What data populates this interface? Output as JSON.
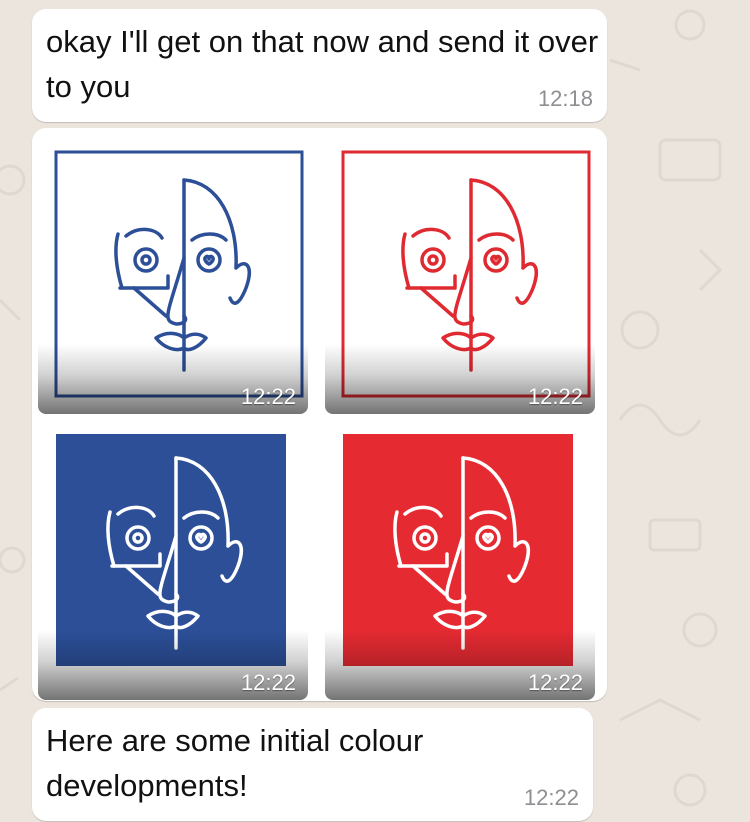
{
  "messages": [
    {
      "text": "okay I'll get on that now and send it over to you",
      "time": "12:18"
    },
    {
      "text": "Here are some initial colour developments!",
      "time": "12:22"
    }
  ],
  "gallery": {
    "images": [
      {
        "time": "12:22",
        "style": "blue-outline",
        "frame": "#2c4f98",
        "fill": "#ffffff",
        "stroke": "#2c4f98"
      },
      {
        "time": "12:22",
        "style": "red-outline",
        "frame": "#e02a31",
        "fill": "#ffffff",
        "stroke": "#e02a31"
      },
      {
        "time": "12:22",
        "style": "blue-solid",
        "frame": "#2c4f98",
        "fill": "#2c4f98",
        "stroke": "#ffffff"
      },
      {
        "time": "12:22",
        "style": "red-solid",
        "frame": "#e52a32",
        "fill": "#e52a32",
        "stroke": "#ffffff"
      }
    ]
  },
  "colors": {
    "chat_background": "#ece5dd",
    "bubble": "#ffffff",
    "timestamp": "#8e8e93"
  }
}
